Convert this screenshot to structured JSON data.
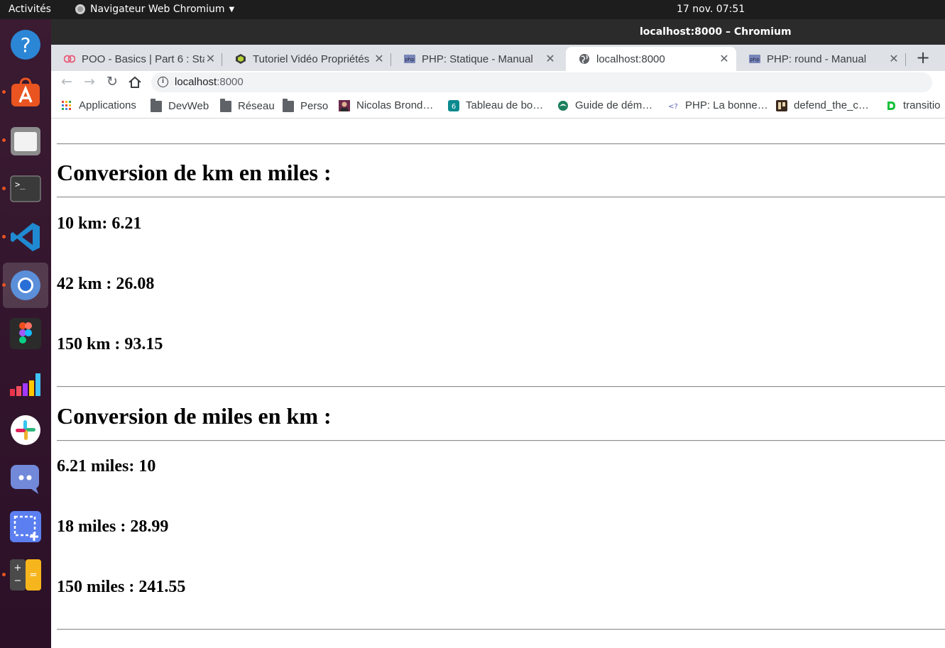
{
  "system": {
    "activities": "Activités",
    "app_menu": "Navigateur Web Chromium",
    "clock": "17 nov.  07:51"
  },
  "window": {
    "title": "localhost:8000 – Chromium"
  },
  "tabs": [
    {
      "label": "POO - Basics | Part 6 : Stat",
      "active": false
    },
    {
      "label": "Tutoriel Vidéo Propriétés",
      "active": false
    },
    {
      "label": "PHP: Statique - Manual",
      "active": false
    },
    {
      "label": "localhost:8000",
      "active": true
    },
    {
      "label": "PHP: round - Manual",
      "active": false
    }
  ],
  "toolbar": {
    "url_host": "localhost",
    "url_port": ":8000"
  },
  "bookmarks": [
    {
      "label": "Applications",
      "icon": "apps-grid-icon"
    },
    {
      "label": "DevWeb",
      "icon": "folder-icon"
    },
    {
      "label": "Réseau",
      "icon": "folder-icon"
    },
    {
      "label": "Perso",
      "icon": "folder-icon"
    },
    {
      "label": "Nicolas Brond…",
      "icon": "avatar-icon"
    },
    {
      "label": "Tableau de bo…",
      "icon": "dashboard-icon"
    },
    {
      "label": "Guide de dém…",
      "icon": "guide-icon"
    },
    {
      "label": "PHP: La bonne…",
      "icon": "code-icon"
    },
    {
      "label": "defend_the_c…",
      "icon": "game-icon"
    },
    {
      "label": "transitio",
      "icon": "d-logo-icon"
    }
  ],
  "dock": [
    {
      "name": "help",
      "running": false
    },
    {
      "name": "software-center",
      "running": true
    },
    {
      "name": "files",
      "running": true
    },
    {
      "name": "terminal",
      "running": true
    },
    {
      "name": "vscode",
      "running": true
    },
    {
      "name": "chromium",
      "running": true,
      "active": true
    },
    {
      "name": "figma",
      "running": false
    },
    {
      "name": "deezer",
      "running": false
    },
    {
      "name": "slack",
      "running": false
    },
    {
      "name": "discord",
      "running": false
    },
    {
      "name": "screenshot",
      "running": false
    },
    {
      "name": "calculator",
      "running": true
    }
  ],
  "content": {
    "section_km": {
      "heading": "Conversion de km en miles :",
      "lines": [
        "10 km: 6.21",
        "42 km : 26.08",
        "150 km : 93.15"
      ]
    },
    "section_miles": {
      "heading": "Conversion de miles en km :",
      "lines": [
        "6.21 miles: 10",
        "18 miles : 28.99",
        "150 miles : 241.55"
      ]
    }
  }
}
